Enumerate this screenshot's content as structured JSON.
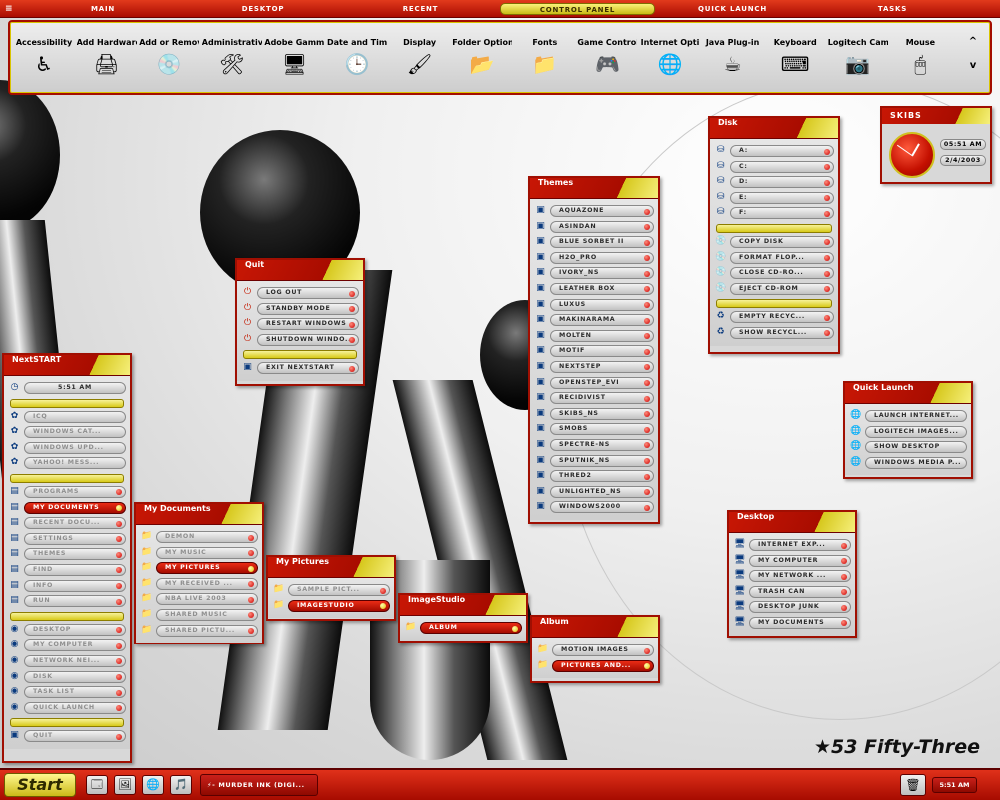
{
  "menubar": {
    "items": [
      "MAIN",
      "DESKTOP",
      "RECENT",
      "CONTROL PANEL",
      "QUICK LAUNCH",
      "TASKS"
    ],
    "active": "CONTROL PANEL",
    "menu_icon": "≡"
  },
  "control_panel": {
    "items": [
      {
        "label": "Accessibility",
        "icon": "♿"
      },
      {
        "label": "Add Hardware",
        "icon": "🖨"
      },
      {
        "label": "Add or Remov",
        "icon": "💿"
      },
      {
        "label": "Administrativ",
        "icon": "🛠"
      },
      {
        "label": "Adobe Gamma",
        "icon": "🖥"
      },
      {
        "label": "Date and Time",
        "icon": "🕒"
      },
      {
        "label": "Display",
        "icon": "🖌"
      },
      {
        "label": "Folder Option",
        "icon": "📂"
      },
      {
        "label": "Fonts",
        "icon": "📁"
      },
      {
        "label": "Game Controll",
        "icon": "🎮"
      },
      {
        "label": "Internet Opti",
        "icon": "🌐"
      },
      {
        "label": "Java Plug-in",
        "icon": "☕"
      },
      {
        "label": "Keyboard",
        "icon": "⌨"
      },
      {
        "label": "Logitech Cam",
        "icon": "📷"
      },
      {
        "label": "Mouse",
        "icon": "🖱"
      }
    ],
    "scroll_up": "^",
    "scroll_down": "v"
  },
  "nextstart": {
    "title": "NextSTART",
    "clock_row": "5:51 AM",
    "pinned": [
      "ICQ",
      "WINDOWS CAT...",
      "WINDOWS UPD...",
      "YAHOO! MESS..."
    ],
    "menu": [
      "PROGRAMS",
      "MY DOCUMENTS",
      "RECENT DOCU...",
      "SETTINGS",
      "THEMES",
      "FIND",
      "INFO",
      "RUN"
    ],
    "places": [
      "DESKTOP",
      "MY COMPUTER",
      "NETWORK NEI...",
      "DISK",
      "TASK LIST",
      "QUICK LAUNCH"
    ],
    "bottom": [
      "QUIT"
    ]
  },
  "my_documents": {
    "title": "My Documents",
    "items": [
      "DEMON",
      "MY MUSIC",
      "MY PICTURES",
      "MY RECEIVED ...",
      "NBA LIVE 2003",
      "SHARED MUSIC",
      "SHARED PICTU..."
    ]
  },
  "my_pictures": {
    "title": "My Pictures",
    "items": [
      "SAMPLE PICT...",
      "IMAGESTUDIO"
    ]
  },
  "imagestudio": {
    "title": "ImageStudio",
    "items": [
      "ALBUM"
    ]
  },
  "album": {
    "title": "Album",
    "items": [
      "MOTION IMAGES",
      "PICTURES AND..."
    ]
  },
  "quit": {
    "title": "Quit",
    "items": [
      "LOG OUT",
      "STANDBY MODE",
      "RESTART WINDOWS",
      "SHUTDOWN WINDO..."
    ],
    "bottom": [
      "EXIT NEXTSTART"
    ]
  },
  "themes": {
    "title": "Themes",
    "items": [
      "AQUAZONE",
      "ASINDAN",
      "BLUE SORBET II",
      "H2O_PRO",
      "IVORY_NS",
      "LEATHER BOX",
      "LUXUS",
      "MAKINARAMA",
      "MOLTEN",
      "MOTIF",
      "NEXTSTEP",
      "OPENSTEP_EVI",
      "RECIDIVIST",
      "SKIBS_NS",
      "SMOBS",
      "SPECTRE-NS",
      "SPUTNIK_NS",
      "THRED2",
      "UNLIGHTED_NS",
      "WINDOWS2000"
    ]
  },
  "disk": {
    "title": "Disk",
    "drives": [
      "A:",
      "C:",
      "D:",
      "E:",
      "F:"
    ],
    "actions": [
      "COPY DISK",
      "FORMAT FLOP...",
      "CLOSE CD-RO...",
      "EJECT CD-ROM"
    ],
    "recycle": [
      "EMPTY RECYC...",
      "SHOW RECYCL..."
    ]
  },
  "clock": {
    "title": "SKIBS",
    "time": "05:51 AM",
    "date": "2/4/2003"
  },
  "quick_launch": {
    "title": "Quick Launch",
    "items": [
      "LAUNCH INTERNET...",
      "LOGITECH IMAGES...",
      "SHOW DESKTOP",
      "WINDOWS MEDIA P..."
    ]
  },
  "desktop": {
    "title": "Desktop",
    "items": [
      "INTERNET EXP...",
      "MY COMPUTER",
      "MY NETWORK ...",
      "TRASH CAN",
      "DESKTOP JUNK",
      "MY DOCUMENTS"
    ]
  },
  "brand": "★53 Fifty-Three",
  "taskbar": {
    "start": "Start",
    "quicklaunch": [
      "🗔",
      "🖼",
      "🌐",
      "🎵"
    ],
    "window": "⚡- MURDER INK (DIGI...",
    "tray_icon": "🗑",
    "clock": "5:51 AM"
  },
  "colors": {
    "accent": "#b3120a",
    "highlight": "#e8dc38",
    "panel": "#d8d8d8"
  }
}
